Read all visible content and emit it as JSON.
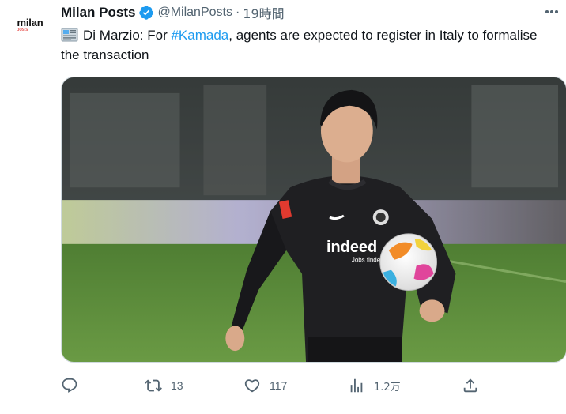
{
  "author": {
    "display_name": "Milan Posts",
    "handle": "@MilanPosts",
    "separator": "·",
    "time": "19時間",
    "avatar_text_main": "milan",
    "avatar_text_sub": "posts",
    "verified": true
  },
  "tweet": {
    "text_before": "Di Marzio: For ",
    "hashtag": "#Kamada",
    "text_after": ", agents are expected to register in Italy to formalise the transaction",
    "media_icon": "newspaper-icon"
  },
  "media": {
    "jersey_sponsor": "indeed",
    "jersey_sponsor_sub": "Jobs finden"
  },
  "actions": {
    "reply_count": "",
    "retweet_count": "13",
    "like_count": "117",
    "views_count": "1.2万"
  },
  "colors": {
    "accent": "#1d9bf0",
    "secondary_text": "#536471",
    "primary_text": "#0f1419"
  }
}
